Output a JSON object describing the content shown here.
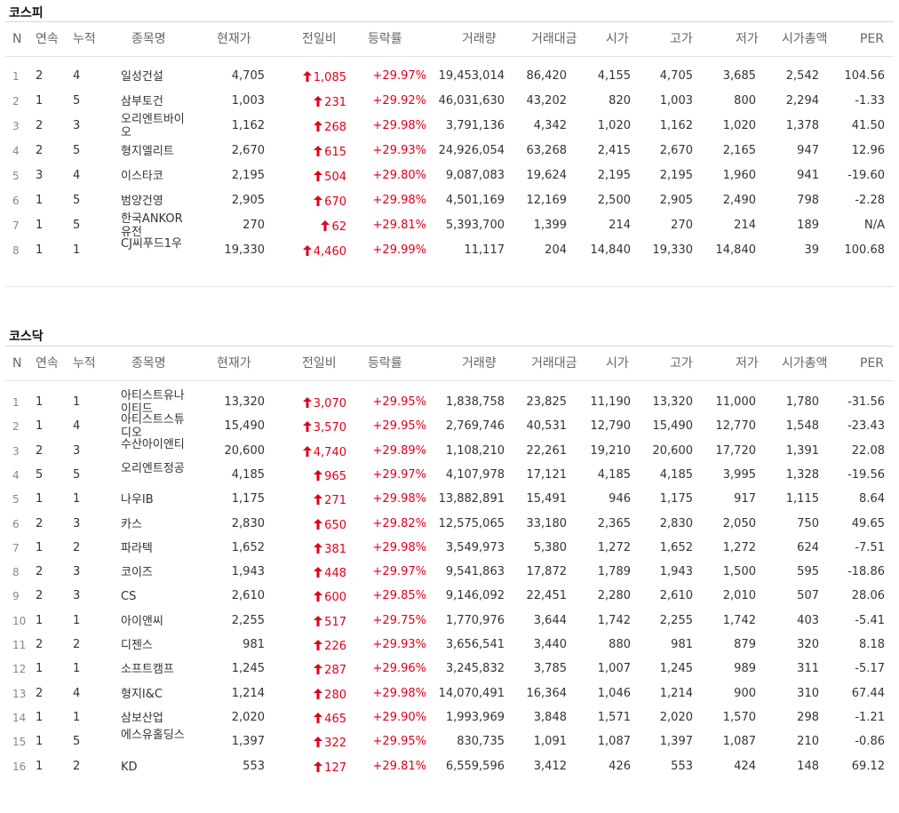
{
  "columns": [
    "N",
    "연속",
    "누적",
    "종목명",
    "현재가",
    "전일비",
    "등락률",
    "거래량",
    "거래대금",
    "시가",
    "고가",
    "저가",
    "시가총액",
    "PER"
  ],
  "colors": {
    "up": "#e0001b",
    "header_text": "#666666",
    "border": "#d8d8d8"
  },
  "sections": [
    {
      "title": "코스피",
      "rows": [
        [
          "1",
          "2",
          "4",
          "일성건설",
          "4,705",
          "1,085",
          "+29.97%",
          "19,453,014",
          "86,420",
          "4,155",
          "4,705",
          "3,685",
          "2,542",
          "104.56"
        ],
        [
          "2",
          "1",
          "5",
          "삼부토건",
          "1,003",
          "231",
          "+29.92%",
          "46,031,630",
          "43,202",
          "820",
          "1,003",
          "800",
          "2,294",
          "-1.33"
        ],
        [
          "3",
          "2",
          "3",
          "오리엔트바이오",
          "1,162",
          "268",
          "+29.98%",
          "3,791,136",
          "4,342",
          "1,020",
          "1,162",
          "1,020",
          "1,378",
          "41.50"
        ],
        [
          "4",
          "2",
          "5",
          "형지엘리트",
          "2,670",
          "615",
          "+29.93%",
          "24,926,054",
          "63,268",
          "2,415",
          "2,670",
          "2,165",
          "947",
          "12.96"
        ],
        [
          "5",
          "3",
          "4",
          "이스타코",
          "2,195",
          "504",
          "+29.80%",
          "9,087,083",
          "19,624",
          "2,195",
          "2,195",
          "1,960",
          "941",
          "-19.60"
        ],
        [
          "6",
          "1",
          "5",
          "범양건영",
          "2,905",
          "670",
          "+29.98%",
          "4,501,169",
          "12,169",
          "2,500",
          "2,905",
          "2,490",
          "798",
          "-2.28"
        ],
        [
          "7",
          "1",
          "5",
          "한국ANKOR유전",
          "270",
          "62",
          "+29.81%",
          "5,393,700",
          "1,399",
          "214",
          "270",
          "214",
          "189",
          "N/A"
        ],
        [
          "8",
          "1",
          "1",
          "CJ씨푸드1우",
          "19,330",
          "4,460",
          "+29.99%",
          "11,117",
          "204",
          "14,840",
          "19,330",
          "14,840",
          "39",
          "100.68"
        ]
      ]
    },
    {
      "title": "코스닥",
      "rows": [
        [
          "1",
          "1",
          "1",
          "아티스트유나이티드",
          "13,320",
          "3,070",
          "+29.95%",
          "1,838,758",
          "23,825",
          "11,190",
          "13,320",
          "11,000",
          "1,780",
          "-31.56"
        ],
        [
          "2",
          "1",
          "4",
          "아티스트스튜디오",
          "15,490",
          "3,570",
          "+29.95%",
          "2,769,746",
          "40,531",
          "12,790",
          "15,490",
          "12,770",
          "1,548",
          "-23.43"
        ],
        [
          "3",
          "2",
          "3",
          "수산아이앤티",
          "20,600",
          "4,740",
          "+29.89%",
          "1,108,210",
          "22,261",
          "19,210",
          "20,600",
          "17,720",
          "1,391",
          "22.08"
        ],
        [
          "4",
          "5",
          "5",
          "오리엔트정공",
          "4,185",
          "965",
          "+29.97%",
          "4,107,978",
          "17,121",
          "4,185",
          "4,185",
          "3,995",
          "1,328",
          "-19.56"
        ],
        [
          "5",
          "1",
          "1",
          "나우IB",
          "1,175",
          "271",
          "+29.98%",
          "13,882,891",
          "15,491",
          "946",
          "1,175",
          "917",
          "1,115",
          "8.64"
        ],
        [
          "6",
          "2",
          "3",
          "카스",
          "2,830",
          "650",
          "+29.82%",
          "12,575,065",
          "33,180",
          "2,365",
          "2,830",
          "2,050",
          "750",
          "49.65"
        ],
        [
          "7",
          "1",
          "2",
          "파라텍",
          "1,652",
          "381",
          "+29.98%",
          "3,549,973",
          "5,380",
          "1,272",
          "1,652",
          "1,272",
          "624",
          "-7.51"
        ],
        [
          "8",
          "2",
          "3",
          "코이즈",
          "1,943",
          "448",
          "+29.97%",
          "9,541,863",
          "17,872",
          "1,789",
          "1,943",
          "1,500",
          "595",
          "-18.86"
        ],
        [
          "9",
          "2",
          "3",
          "CS",
          "2,610",
          "600",
          "+29.85%",
          "9,146,092",
          "22,451",
          "2,280",
          "2,610",
          "2,010",
          "507",
          "28.06"
        ],
        [
          "10",
          "1",
          "1",
          "아이앤씨",
          "2,255",
          "517",
          "+29.75%",
          "1,770,976",
          "3,644",
          "1,742",
          "2,255",
          "1,742",
          "403",
          "-5.41"
        ],
        [
          "11",
          "2",
          "2",
          "디젠스",
          "981",
          "226",
          "+29.93%",
          "3,656,541",
          "3,440",
          "880",
          "981",
          "879",
          "320",
          "8.18"
        ],
        [
          "12",
          "1",
          "1",
          "소프트캠프",
          "1,245",
          "287",
          "+29.96%",
          "3,245,832",
          "3,785",
          "1,007",
          "1,245",
          "989",
          "311",
          "-5.17"
        ],
        [
          "13",
          "2",
          "4",
          "형지I&C",
          "1,214",
          "280",
          "+29.98%",
          "14,070,491",
          "16,364",
          "1,046",
          "1,214",
          "900",
          "310",
          "67.44"
        ],
        [
          "14",
          "1",
          "1",
          "삼보산업",
          "2,020",
          "465",
          "+29.90%",
          "1,993,969",
          "3,848",
          "1,571",
          "2,020",
          "1,570",
          "298",
          "-1.21"
        ],
        [
          "15",
          "1",
          "5",
          "에스유홀딩스",
          "1,397",
          "322",
          "+29.95%",
          "830,735",
          "1,091",
          "1,087",
          "1,397",
          "1,087",
          "210",
          "-0.86"
        ],
        [
          "16",
          "1",
          "2",
          "KD",
          "553",
          "127",
          "+29.81%",
          "6,559,596",
          "3,412",
          "426",
          "553",
          "424",
          "148",
          "69.12"
        ]
      ]
    }
  ]
}
